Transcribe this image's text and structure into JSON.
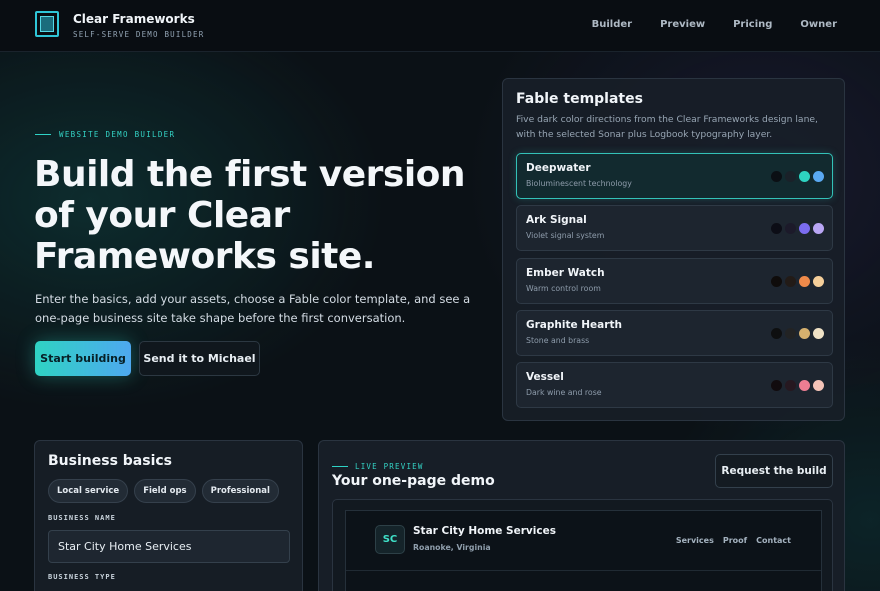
{
  "header": {
    "brand_name": "Clear Frameworks",
    "brand_sub": "SELF-SERVE DEMO BUILDER",
    "nav": [
      "Builder",
      "Preview",
      "Pricing",
      "Owner"
    ]
  },
  "hero": {
    "eyebrow": "WEBSITE DEMO BUILDER",
    "title": "Build the first version of your Clear Frameworks site.",
    "description": "Enter the basics, add your assets, choose a Fable color template, and see a one-page business site take shape before the first conversation.",
    "primary_button": "Start building",
    "secondary_button": "Send it to Michael"
  },
  "templates": {
    "title": "Fable templates",
    "description": "Five dark color directions from the Clear Frameworks design lane, with the selected Sonar plus Logbook typography layer.",
    "items": [
      {
        "name": "Deepwater",
        "sub": "Bioluminescent technology",
        "selected": true,
        "swatches": [
          "#0b0f14",
          "#1a2129",
          "#2ed3c1",
          "#5aa9f2"
        ]
      },
      {
        "name": "Ark Signal",
        "sub": "Violet signal system",
        "selected": false,
        "swatches": [
          "#0c0d16",
          "#1c1a2a",
          "#7b6cf0",
          "#b9a6f4"
        ]
      },
      {
        "name": "Ember Watch",
        "sub": "Warm control room",
        "selected": false,
        "swatches": [
          "#0f0c0b",
          "#221b17",
          "#ef8a4a",
          "#f5cf9a"
        ]
      },
      {
        "name": "Graphite Hearth",
        "sub": "Stone and brass",
        "selected": false,
        "swatches": [
          "#0e0f10",
          "#222324",
          "#d5b06e",
          "#efe2c6"
        ]
      },
      {
        "name": "Vessel",
        "sub": "Dark wine and rose",
        "selected": false,
        "swatches": [
          "#110b0e",
          "#261820",
          "#ec7d92",
          "#f4c4b8"
        ]
      }
    ]
  },
  "basics": {
    "title": "Business basics",
    "chips": [
      "Local service",
      "Field ops",
      "Professional"
    ],
    "business_name_label": "BUSINESS NAME",
    "business_name_value": "Star City Home Services",
    "business_type_label": "BUSINESS TYPE"
  },
  "preview": {
    "eyebrow": "LIVE PREVIEW",
    "title": "Your one-page demo",
    "request_button": "Request the build",
    "site": {
      "badge": "SC",
      "name": "Star City Home Services",
      "location": "Roanoke, Virginia",
      "nav": [
        "Services",
        "Proof",
        "Contact"
      ]
    }
  }
}
